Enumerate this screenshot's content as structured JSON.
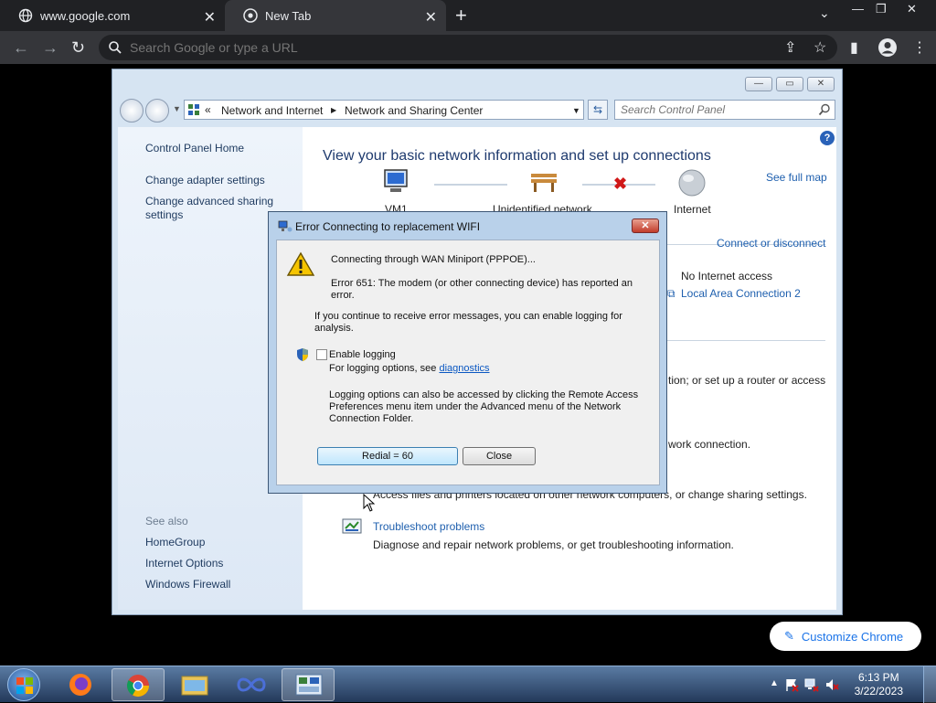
{
  "browser": {
    "tabs": [
      {
        "label": "www.google.com",
        "close": "✕"
      },
      {
        "label": "New Tab",
        "close": "✕"
      }
    ],
    "new_tab": "+",
    "tab_menu": "⌄",
    "window_controls": [
      "—",
      "❐",
      "✕"
    ],
    "omnibox_placeholder": "Search Google or type a URL",
    "customize_label": "Customize Chrome"
  },
  "control_panel": {
    "breadcrumb": [
      "«",
      "Network and Internet",
      "Network and Sharing Center"
    ],
    "search_placeholder": "Search Control Panel",
    "sidebar": {
      "home": "Control Panel Home",
      "links": [
        "Change adapter settings",
        "Change advanced sharing settings"
      ],
      "see_also_heading": "See also",
      "see_also": [
        "HomeGroup",
        "Internet Options",
        "Windows Firewall"
      ]
    },
    "main": {
      "heading": "View your basic network information and set up connections",
      "see_full_map": "See full map",
      "nodes": [
        "VM1",
        "Unidentified network",
        "Internet"
      ],
      "connect_disconnect": "Connect or disconnect",
      "no_internet": "No Internet access",
      "local_area": "Local Area Connection 2",
      "setup_text_tail": "tion; or set up a router or access",
      "network_connection_tail": "work connection.",
      "access_files_text": "Access files and printers located on other network computers, or change sharing settings.",
      "troubleshoot_link": "Troubleshoot problems",
      "troubleshoot_desc": "Diagnose and repair network problems, or get troubleshooting information."
    }
  },
  "dialog": {
    "title": "Error Connecting to replacement WIFI",
    "connecting": "Connecting through WAN Miniport (PPPOE)...",
    "error_line1": "Error 651: The modem (or other connecting device) has reported an",
    "error_line2": "error.",
    "logging_hint_1": "If you continue to receive error messages, you can enable logging for",
    "logging_hint_2": "analysis.",
    "enable_logging": "Enable logging",
    "options_prefix": "For logging options, see",
    "diagnostics_link": "diagnostics",
    "note_1": "Logging options can also be accessed by clicking the Remote Access",
    "note_2": "Preferences menu item under the Advanced menu of the Network",
    "note_3": "Connection Folder.",
    "redial_label": "Redial = 60",
    "close_label": "Close",
    "close_x": "✕"
  },
  "taskbar": {
    "time": "6:13 PM",
    "date": "3/22/2023"
  }
}
